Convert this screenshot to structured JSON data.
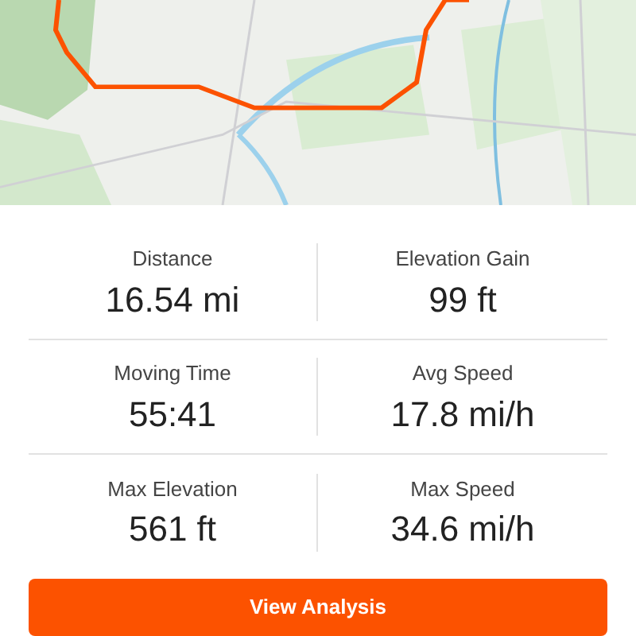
{
  "stats": [
    {
      "label": "Distance",
      "value": "16.54 mi"
    },
    {
      "label": "Elevation Gain",
      "value": "99 ft"
    },
    {
      "label": "Moving Time",
      "value": "55:41"
    },
    {
      "label": "Avg Speed",
      "value": "17.8 mi/h"
    },
    {
      "label": "Max Elevation",
      "value": "561 ft"
    },
    {
      "label": "Max Speed",
      "value": "34.6 mi/h"
    }
  ],
  "button": {
    "label": "View Analysis"
  }
}
